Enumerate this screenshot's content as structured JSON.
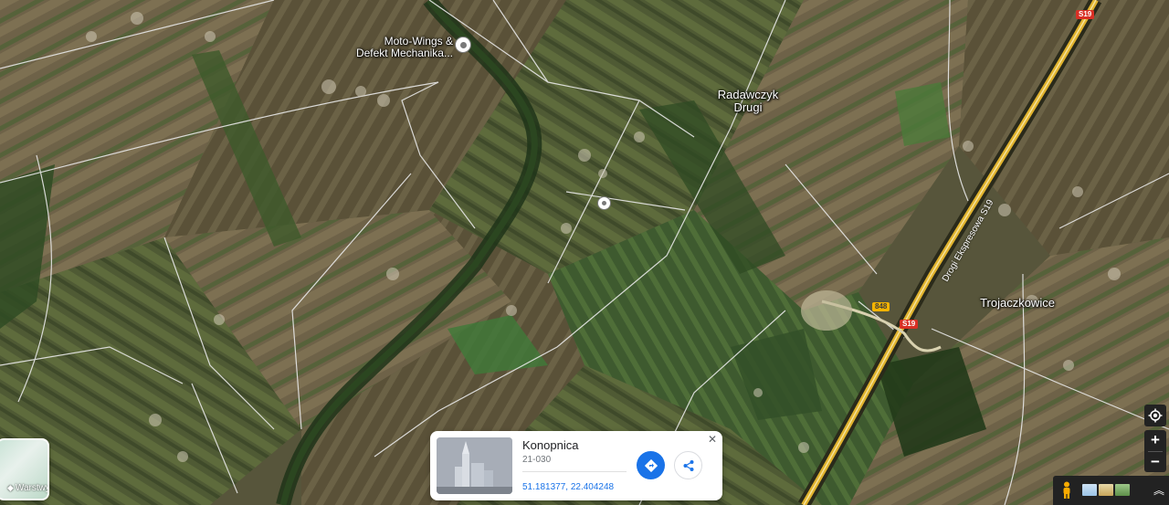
{
  "map": {
    "labels": {
      "poi_name": "Moto-Wings &\nDefekt Mechanika...",
      "village_radawczyk": "Radawczyk\nDrugi",
      "village_trojaczkowice": "Trojaczkowice",
      "road_name": "Drogi Ekspresowa S19"
    },
    "road_badges": {
      "s19_top": "S19",
      "s19_mid": "S19",
      "dk848": "848"
    }
  },
  "layers": {
    "label": "Warstwy",
    "icon": "layers-icon"
  },
  "info_card": {
    "name": "Konopnica",
    "postal_code": "21-030",
    "coordinates": "51.181377, 22.404248",
    "directions_icon": "directions-icon",
    "share_icon": "share-icon",
    "close_label": "✕"
  },
  "controls": {
    "locate_icon": "my-location-icon",
    "zoom_in_label": "+",
    "zoom_out_label": "−",
    "expand_label": "︽"
  },
  "colors": {
    "accent": "#1a73e8",
    "road_badge_red": "#d93025",
    "road_badge_yellow": "#f4b400"
  }
}
